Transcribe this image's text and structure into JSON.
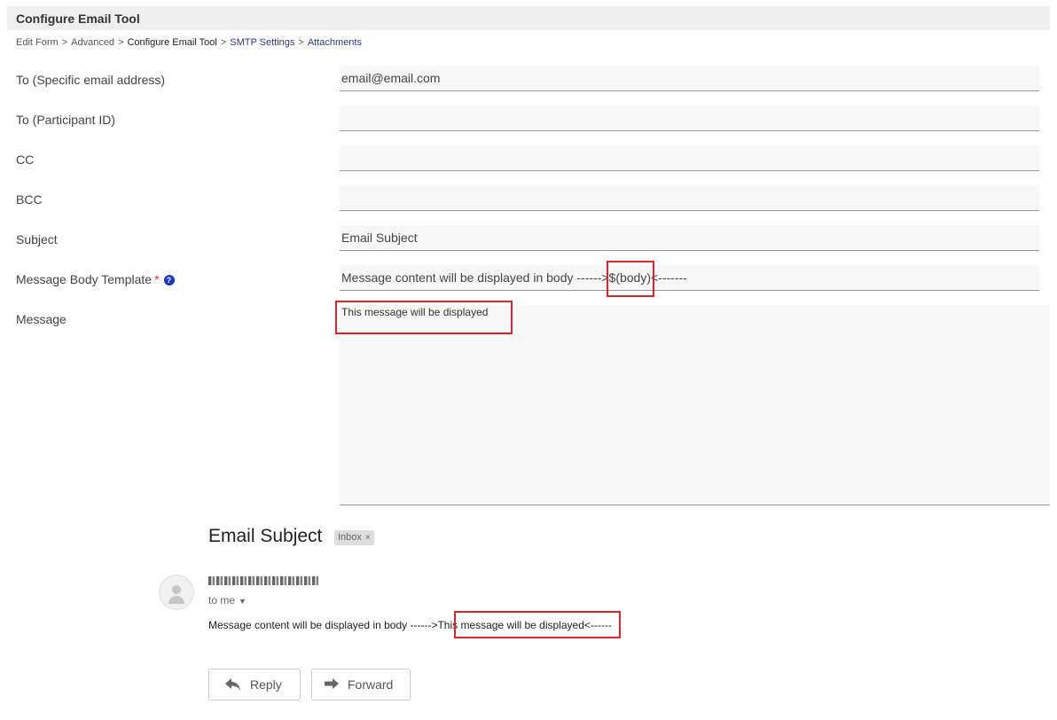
{
  "header": {
    "title": "Configure Email Tool"
  },
  "breadcrumb": {
    "items": [
      "Edit Form",
      "Advanced",
      "Configure Email Tool",
      "SMTP Settings",
      "Attachments"
    ],
    "separator": ">"
  },
  "form": {
    "to_email": {
      "label": "To (Specific email address)",
      "value": "email@email.com"
    },
    "to_participant": {
      "label": "To (Participant ID)",
      "value": ""
    },
    "cc": {
      "label": "CC",
      "value": ""
    },
    "bcc": {
      "label": "BCC",
      "value": ""
    },
    "subject": {
      "label": "Subject",
      "value": "Email Subject"
    },
    "body_template": {
      "label": "Message Body Template",
      "required_marker": "*",
      "value": "Message content will be displayed in body ------>$(body)<-------"
    },
    "message": {
      "label": "Message",
      "value": "This message will be displayed"
    }
  },
  "email_preview": {
    "subject": "Email Subject",
    "label_chip": "Inbox",
    "chip_close": "×",
    "recipient": "to me",
    "body_prefix": "Message content will be displayed in body ------>",
    "body_highlight": "This message will be displayed",
    "body_suffix": "<------",
    "reply_label": "Reply",
    "forward_label": "Forward"
  },
  "colors": {
    "highlight_box": "#d9252b",
    "help_icon": "#1a37c7",
    "link": "#2b3a8a"
  }
}
